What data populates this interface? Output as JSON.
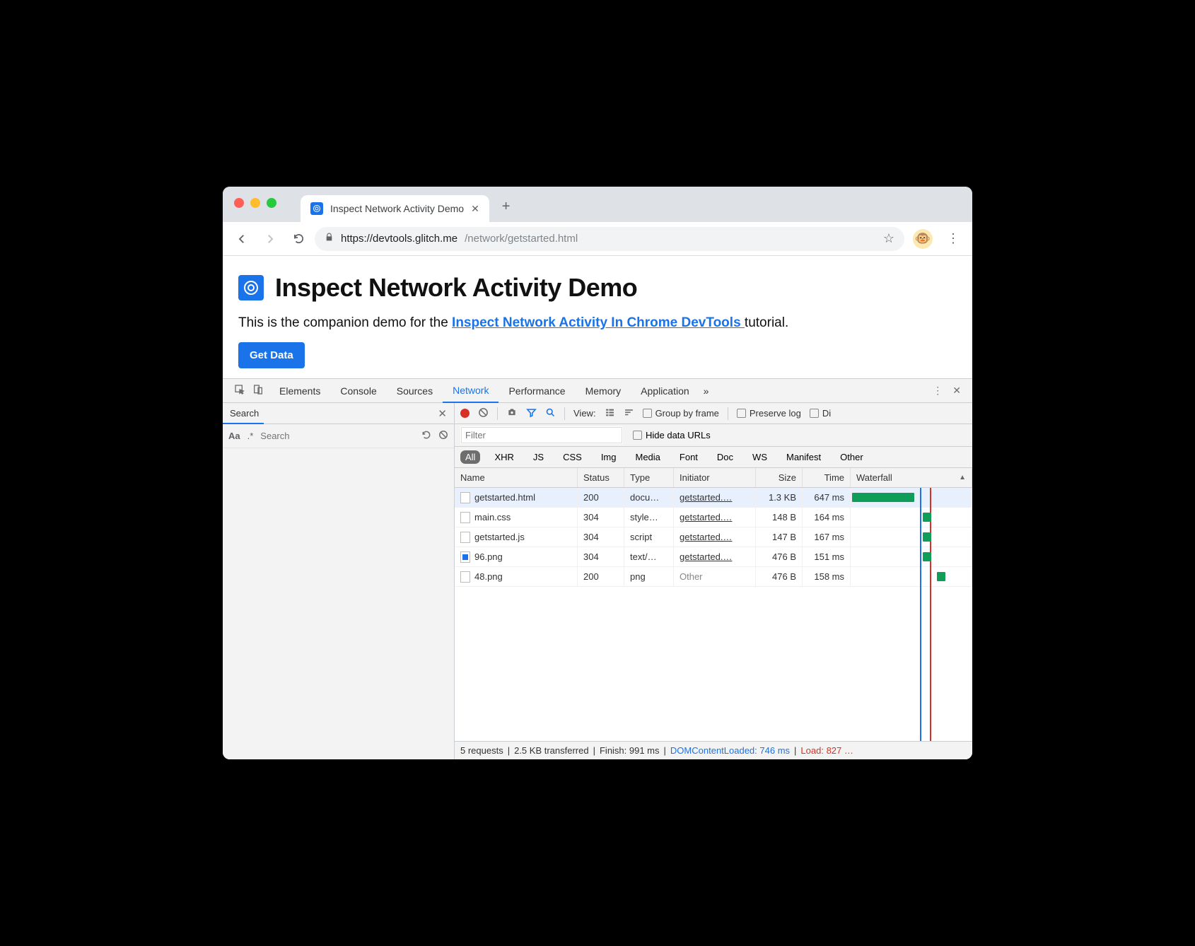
{
  "browser": {
    "tab_title": "Inspect Network Activity Demo",
    "url_host": "https://devtools.glitch.me",
    "url_path": "/network/getstarted.html"
  },
  "page": {
    "heading": "Inspect Network Activity Demo",
    "para_before": "This is the companion demo for the ",
    "para_link": "Inspect Network Activity In Chrome DevTools ",
    "para_after": "tutorial.",
    "button": "Get Data"
  },
  "devtools": {
    "tabs": [
      "Elements",
      "Console",
      "Sources",
      "Network",
      "Performance",
      "Memory",
      "Application"
    ],
    "active_tab": "Network",
    "search": {
      "title": "Search",
      "aa": "Aa",
      "regex": ".*",
      "placeholder": "Search"
    },
    "net_toolbar": {
      "view_label": "View:",
      "group": "Group by frame",
      "preserve": "Preserve log",
      "disable": "Di"
    },
    "filter": {
      "placeholder": "Filter",
      "hide": "Hide data URLs"
    },
    "types": [
      "All",
      "XHR",
      "JS",
      "CSS",
      "Img",
      "Media",
      "Font",
      "Doc",
      "WS",
      "Manifest",
      "Other"
    ],
    "columns": {
      "name": "Name",
      "status": "Status",
      "type": "Type",
      "initiator": "Initiator",
      "size": "Size",
      "time": "Time",
      "waterfall": "Waterfall"
    },
    "rows": [
      {
        "name": "getstarted.html",
        "status": "200",
        "type": "docu…",
        "initiator": "getstarted.…",
        "size": "1.3 KB",
        "time": "647 ms",
        "wleft": 2,
        "wwidth": 88,
        "selected": true,
        "img": false
      },
      {
        "name": "main.css",
        "status": "304",
        "type": "style…",
        "initiator": "getstarted.…",
        "size": "148 B",
        "time": "164 ms",
        "wleft": 102,
        "wwidth": 12,
        "selected": false,
        "img": false
      },
      {
        "name": "getstarted.js",
        "status": "304",
        "type": "script",
        "initiator": "getstarted.…",
        "size": "147 B",
        "time": "167 ms",
        "wleft": 102,
        "wwidth": 12,
        "selected": false,
        "img": false
      },
      {
        "name": "96.png",
        "status": "304",
        "type": "text/…",
        "initiator": "getstarted.…",
        "size": "476 B",
        "time": "151 ms",
        "wleft": 102,
        "wwidth": 12,
        "selected": false,
        "img": true
      },
      {
        "name": "48.png",
        "status": "200",
        "type": "png",
        "initiator": "Other",
        "size": "476 B",
        "time": "158 ms",
        "wleft": 122,
        "wwidth": 12,
        "selected": false,
        "img": false,
        "other": true
      }
    ],
    "status": {
      "requests": "5 requests",
      "transferred": "2.5 KB transferred",
      "finish": "Finish: 991 ms",
      "dcl": "DOMContentLoaded: 746 ms",
      "load": "Load: 827 …"
    }
  }
}
